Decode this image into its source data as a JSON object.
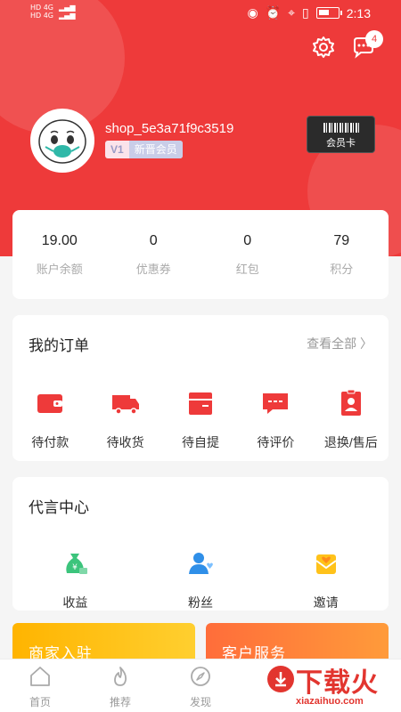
{
  "status_bar": {
    "time": "2:13",
    "left_rows": [
      "HD 4G",
      "HD 4G"
    ],
    "battery_level": 0.55
  },
  "header": {
    "message_badge": "4",
    "username": "shop_5e3a71f9c3519",
    "level": "V1",
    "level_name": "新晋会员",
    "member_card_label": "会员卡"
  },
  "stats": [
    {
      "value": "19.00",
      "label": "账户余额"
    },
    {
      "value": "0",
      "label": "优惠券"
    },
    {
      "value": "0",
      "label": "红包"
    },
    {
      "value": "79",
      "label": "积分"
    }
  ],
  "orders": {
    "title": "我的订单",
    "view_all": "查看全部 〉",
    "items": [
      {
        "label": "待付款",
        "icon": "wallet-icon"
      },
      {
        "label": "待收货",
        "icon": "truck-icon"
      },
      {
        "label": "待自提",
        "icon": "box-icon"
      },
      {
        "label": "待评价",
        "icon": "comment-icon"
      },
      {
        "label": "退换/售后",
        "icon": "return-icon"
      }
    ]
  },
  "ambassador": {
    "title": "代言中心",
    "items": [
      {
        "label": "收益",
        "icon": "money-bag-icon"
      },
      {
        "label": "粉丝",
        "icon": "fans-icon"
      },
      {
        "label": "邀请",
        "icon": "invite-icon"
      }
    ]
  },
  "promos": [
    {
      "label": "商家入驻"
    },
    {
      "label": "客户服务"
    }
  ],
  "tabbar": [
    {
      "label": "首页",
      "icon": "home-icon"
    },
    {
      "label": "推荐",
      "icon": "flame-icon"
    },
    {
      "label": "发现",
      "icon": "compass-icon"
    }
  ],
  "watermark": {
    "text": "下载火",
    "url": "xiazaihuo.com"
  },
  "colors": {
    "brand_red": "#ee3a3a",
    "promo_yellow": "#ffc21a",
    "promo_orange": "#ff7b3a"
  }
}
